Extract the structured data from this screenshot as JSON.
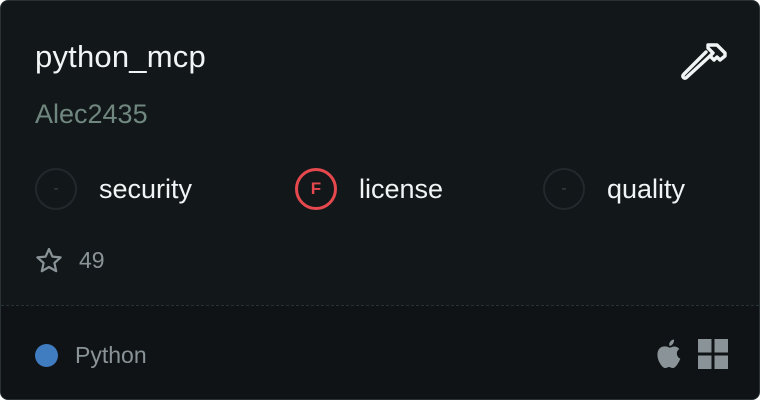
{
  "server": {
    "name": "python_mcp",
    "author": "Alec2435"
  },
  "header_icon": "hammer-icon",
  "scores": [
    {
      "grade": "-",
      "label": "security",
      "status": "none"
    },
    {
      "grade": "F",
      "label": "license",
      "status": "fail"
    },
    {
      "grade": "-",
      "label": "quality",
      "status": "none"
    }
  ],
  "stars": {
    "icon": "star-icon",
    "count": "49"
  },
  "footer": {
    "language": "Python",
    "language_color": "#3f7cc0",
    "platform_icons": [
      "apple-icon",
      "windows-icon"
    ]
  },
  "colors": {
    "fail": "#e5484d",
    "background": "#121719"
  }
}
